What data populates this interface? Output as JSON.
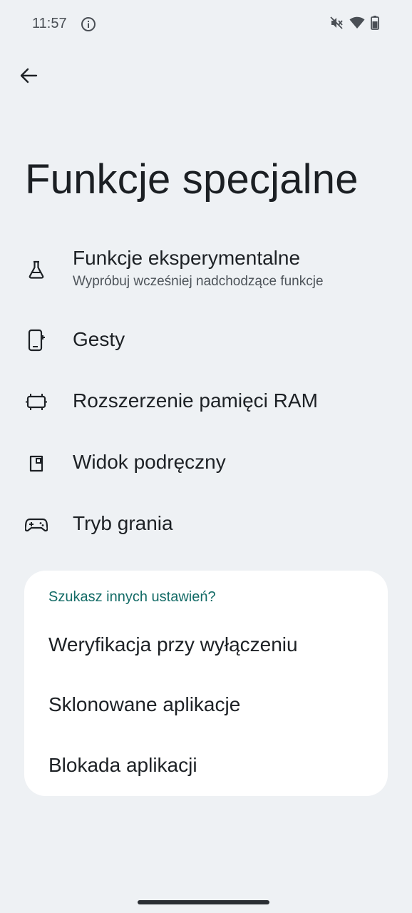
{
  "status_bar": {
    "time": "11:57",
    "icons": [
      "info-icon",
      "mute-icon",
      "wifi-icon",
      "battery-icon"
    ]
  },
  "header": {
    "title": "Funkcje specjalne"
  },
  "items": [
    {
      "icon": "flask-icon",
      "label": "Funkcje eksperymentalne",
      "subtitle": "Wypróbuj wcześniej nadchodzące funkcje"
    },
    {
      "icon": "gesture-phone-icon",
      "label": "Gesty"
    },
    {
      "icon": "memory-chip-icon",
      "label": "Rozszerzenie pamięci RAM"
    },
    {
      "icon": "pocket-view-icon",
      "label": "Widok podręczny"
    },
    {
      "icon": "gamepad-icon",
      "label": "Tryb grania"
    }
  ],
  "suggestions": {
    "heading": "Szukasz innych ustawień?",
    "items": [
      "Weryfikacja przy wyłączeniu",
      "Sklonowane aplikacje",
      "Blokada aplikacji"
    ]
  },
  "colors": {
    "background": "#eef1f4",
    "card": "#ffffff",
    "accent": "#136b66",
    "text": "#1d2125"
  }
}
